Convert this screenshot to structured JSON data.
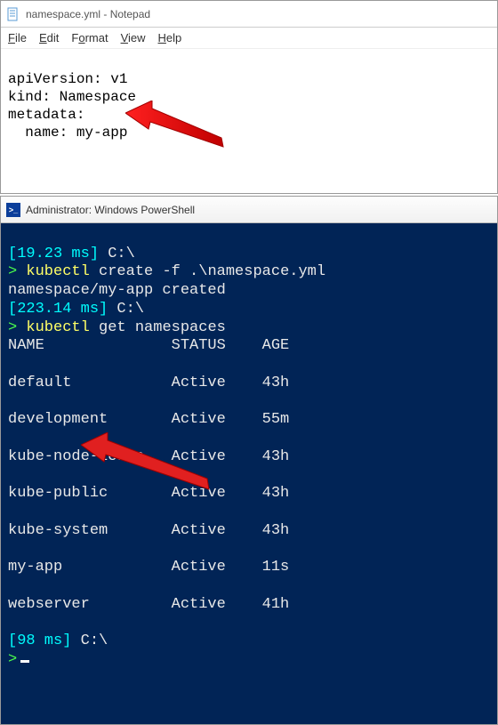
{
  "notepad": {
    "title": "namespace.yml - Notepad",
    "menu": {
      "file": "File",
      "edit": "Edit",
      "format": "Format",
      "view": "View",
      "help": "Help"
    },
    "lines": {
      "l1": "apiVersion: v1",
      "l2": "kind: Namespace",
      "l3": "metadata:",
      "l4": "name: my-app"
    }
  },
  "powershell": {
    "title": "Administrator: Windows PowerShell",
    "timing1": "[19.23 ms]",
    "prompt_path": " C:\\",
    "prompt_sym": ">",
    "cmd1_a": " kubectl",
    "cmd1_b": " create -f .\\namespace.yml",
    "out1": "namespace/my-app created",
    "timing2": "[223.14 ms]",
    "cmd2_a": " kubectl",
    "cmd2_b": " get namespaces",
    "header": {
      "name": "NAME",
      "status": "STATUS",
      "age": "AGE"
    },
    "rows": [
      {
        "name": "default",
        "status": "Active",
        "age": "43h"
      },
      {
        "name": "development",
        "status": "Active",
        "age": "55m"
      },
      {
        "name": "kube-node-lease",
        "status": "Active",
        "age": "43h"
      },
      {
        "name": "kube-public",
        "status": "Active",
        "age": "43h"
      },
      {
        "name": "kube-system",
        "status": "Active",
        "age": "43h"
      },
      {
        "name": "my-app",
        "status": "Active",
        "age": "11s"
      },
      {
        "name": "webserver",
        "status": "Active",
        "age": "41h"
      }
    ],
    "timing3": "[98 ms]"
  }
}
